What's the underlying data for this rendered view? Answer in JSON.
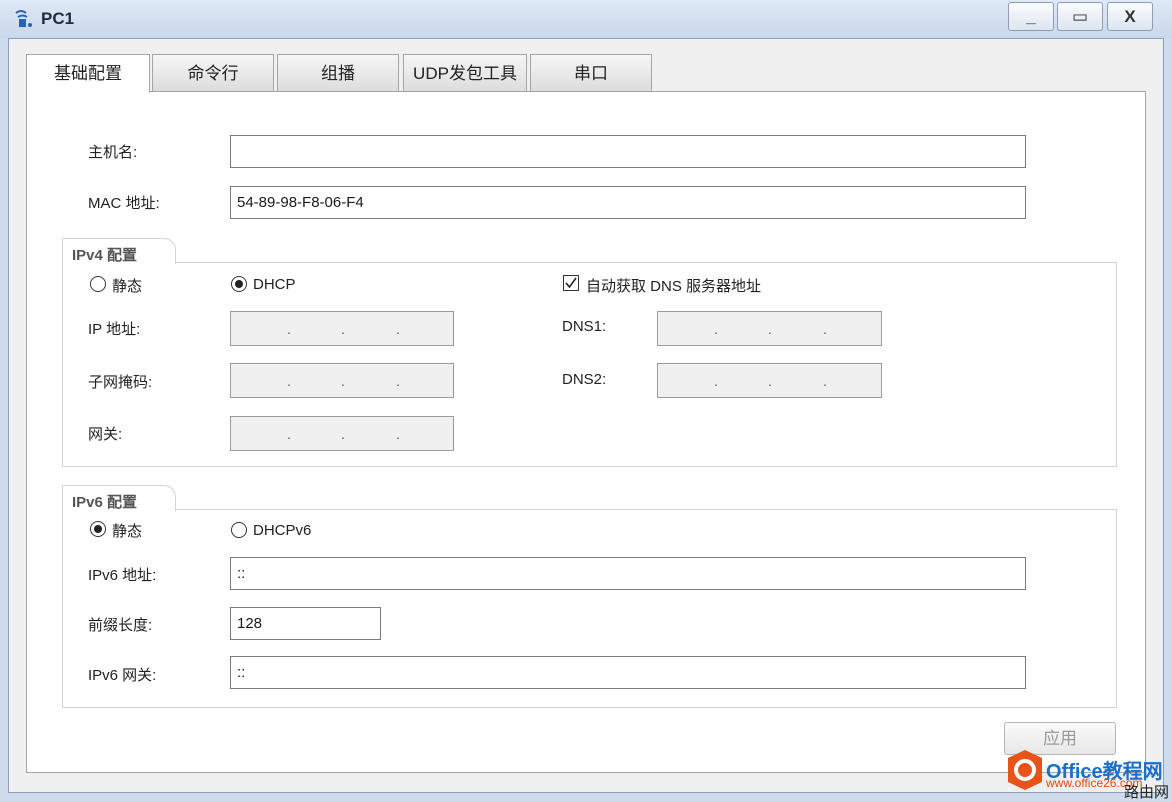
{
  "window": {
    "title": "PC1"
  },
  "tabs": [
    {
      "label": "基础配置"
    },
    {
      "label": "命令行"
    },
    {
      "label": "组播"
    },
    {
      "label": "UDP发包工具"
    },
    {
      "label": "串口"
    }
  ],
  "basic": {
    "hostname_label": "主机名:",
    "hostname_value": "",
    "mac_label": "MAC 地址:",
    "mac_value": "54-89-98-F8-06-F4"
  },
  "ipv4": {
    "group_title": "IPv4 配置",
    "static_label": "静态",
    "dhcp_label": "DHCP",
    "mode": "DHCP",
    "auto_dns_label": "自动获取 DNS 服务器地址",
    "auto_dns_checked": true,
    "ip_label": "IP 地址:",
    "mask_label": "子网掩码:",
    "gateway_label": "网关:",
    "dns1_label": "DNS1:",
    "dns2_label": "DNS2:"
  },
  "ipv6": {
    "group_title": "IPv6 配置",
    "static_label": "静态",
    "dhcpv6_label": "DHCPv6",
    "mode": "静态",
    "address_label": "IPv6 地址:",
    "address_value": "::",
    "prefix_label": "前缀长度:",
    "prefix_value": "128",
    "gateway_label": "IPv6 网关:",
    "gateway_value": "::"
  },
  "apply_label": "应用",
  "watermark": {
    "brand": "Office教程网",
    "url": "www.office26.com",
    "sub": "路由网"
  },
  "colors": {
    "brand": "#1a6fc9",
    "accent": "#e04a10"
  },
  "icons": {
    "app": "network-pc-icon",
    "minimize": "minimize-icon",
    "maximize": "maximize-icon",
    "close": "close-icon"
  }
}
